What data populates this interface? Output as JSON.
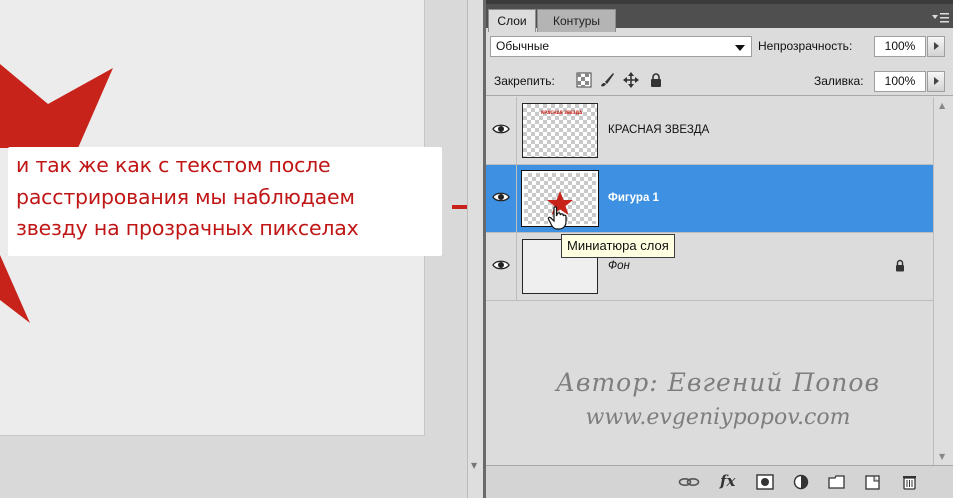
{
  "panel": {
    "tabs": [
      {
        "label": "Слои"
      },
      {
        "label": "Контуры"
      }
    ],
    "blend_mode": "Обычные",
    "opacity_label": "Непрозрачность:",
    "opacity_value": "100%",
    "lock_label": "Закрепить:",
    "fill_label": "Заливка:",
    "fill_value": "100%"
  },
  "layers": [
    {
      "name": "КРАСНАЯ ЗВЕЗДА",
      "visible": true,
      "selected": false,
      "thumb_text": "КРАСНАЯ ЗВЕЗДА"
    },
    {
      "name": "Фигура 1",
      "visible": true,
      "selected": true
    },
    {
      "name": "Фон",
      "visible": true,
      "selected": false,
      "locked": true
    }
  ],
  "tooltip": "Миниатюра слоя",
  "annotation": {
    "lines": [
      "и так же как с текстом после",
      "расстрирования мы наблюдаем",
      "звезду на прозрачных пикселах"
    ]
  },
  "watermark": {
    "author": "Автор: Евгений Попов",
    "url": "www.evgeniypopov.com"
  },
  "bottom_toolbar": {
    "fx_label": "fx"
  },
  "colors": {
    "accent_selected": "#3d90e2",
    "annotation_text": "#c01616",
    "star_red": "#c8231a"
  }
}
